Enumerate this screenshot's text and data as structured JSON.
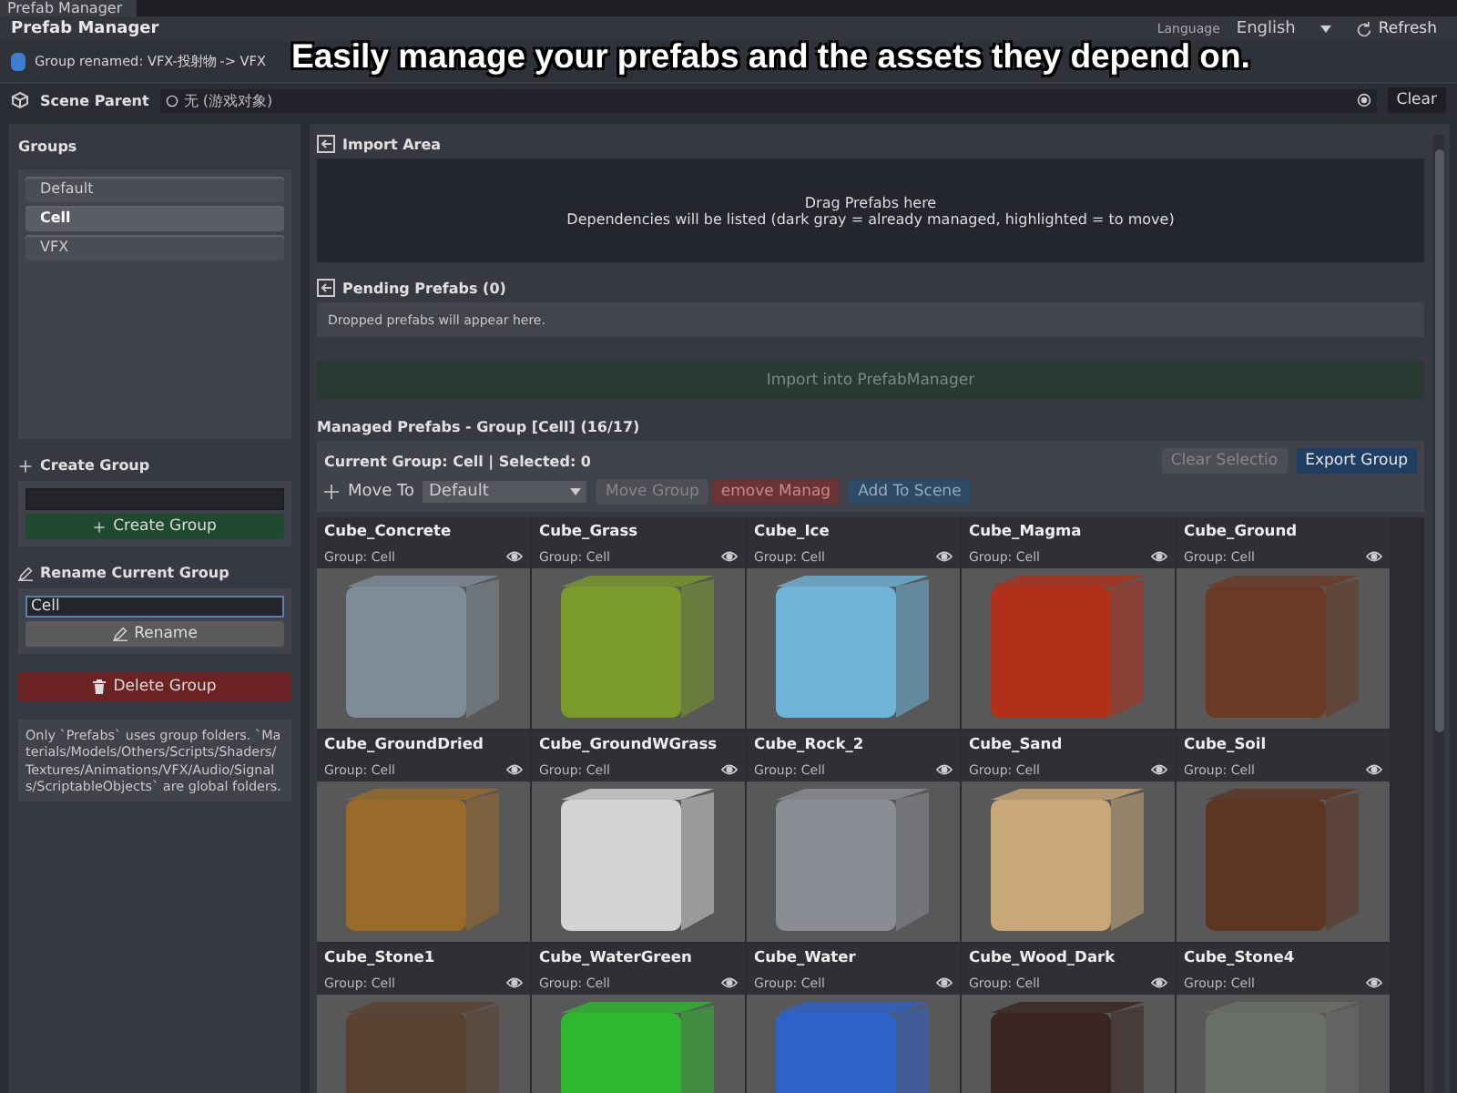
{
  "window": {
    "tab": "Prefab Manager",
    "title": "Prefab Manager",
    "language_label": "Language",
    "language": "English",
    "refresh": "Refresh"
  },
  "caption": "Easily manage your prefabs and the assets they depend on.",
  "notification": "Group renamed: VFX-投射物 -> VFX",
  "scene_parent": {
    "label": "Scene Parent",
    "value": "无 (游戏对象)",
    "clear": "Clear"
  },
  "groups": {
    "title": "Groups",
    "items": [
      {
        "label": "Default",
        "selected": false
      },
      {
        "label": "Cell",
        "selected": true
      },
      {
        "label": "VFX",
        "selected": false
      }
    ]
  },
  "create_group": {
    "title": "Create Group",
    "button": "Create Group"
  },
  "rename_group": {
    "title": "Rename Current Group",
    "value": "Cell",
    "button": "Rename"
  },
  "delete_button": "Delete Group",
  "info": "Only `Prefabs` uses group folders. `Materials/Models/Others/Scripts/Shaders/Textures/Animations/VFX/Audio/Signals/ScriptableObjects` are global folders.",
  "import_area": {
    "title": "Import Area",
    "drop_line_1": "Drag Prefabs here",
    "drop_line_2": "Dependencies will be listed (dark gray = already managed, highlighted = to move)"
  },
  "pending": {
    "title": "Pending Prefabs (0)",
    "empty": "Dropped prefabs will appear here.",
    "import_button": "Import into PrefabManager"
  },
  "managed": {
    "title": "Managed Prefabs - Group [Cell] (16/17)",
    "status": "Current Group: Cell | Selected: 0",
    "clear_selection": "Clear Selectio",
    "export": "Export Group",
    "move_to": "Move To",
    "move_target": "Default",
    "move_group": "Move Group",
    "remove": "emove Manag",
    "add_to_scene": "Add To Scene"
  },
  "prefabs": [
    {
      "name": "Cube_Concrete",
      "group": "Group: Cell",
      "color": "#7f8c98"
    },
    {
      "name": "Cube_Grass",
      "group": "Group: Cell",
      "color": "#7a9a2a"
    },
    {
      "name": "Cube_Ice",
      "group": "Group: Cell",
      "color": "#6fb4d8"
    },
    {
      "name": "Cube_Magma",
      "group": "Group: Cell",
      "color": "#b0301a"
    },
    {
      "name": "Cube_Ground",
      "group": "Group: Cell",
      "color": "#6a3a24"
    },
    {
      "name": "Cube_GroundDried",
      "group": "Group: Cell",
      "color": "#9a6a2a"
    },
    {
      "name": "Cube_GroundWGrass",
      "group": "Group: Cell",
      "color": "#d4d4d4"
    },
    {
      "name": "Cube_Rock_2",
      "group": "Group: Cell",
      "color": "#8a8e94"
    },
    {
      "name": "Cube_Sand",
      "group": "Group: Cell",
      "color": "#c9a878"
    },
    {
      "name": "Cube_Soil",
      "group": "Group: Cell",
      "color": "#5e3422"
    },
    {
      "name": "Cube_Stone1",
      "group": "Group: Cell",
      "color": "#5a4232"
    },
    {
      "name": "Cube_WaterGreen",
      "group": "Group: Cell",
      "color": "#2fb82f"
    },
    {
      "name": "Cube_Water",
      "group": "Group: Cell",
      "color": "#2f62c8"
    },
    {
      "name": "Cube_Wood_Dark",
      "group": "Group: Cell",
      "color": "#3a2620"
    },
    {
      "name": "Cube_Stone4",
      "group": "Group: Cell",
      "color": "#6a7068"
    }
  ]
}
